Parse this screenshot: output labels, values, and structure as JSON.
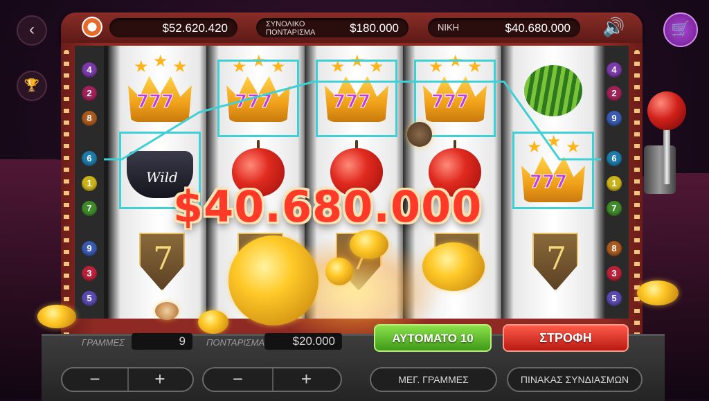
{
  "header": {
    "balance": "$52.620.420",
    "total_bet_label_line1": "ΣΥΝΟΛΙΚΟ",
    "total_bet_label_line2": "ΠΟΝΤΑΡΙΣΜΑ",
    "total_bet": "$180.000",
    "win_label": "ΝΙΚΗ",
    "win_value": "$40.680.000"
  },
  "left_numbers": [
    "4",
    "2",
    "8",
    "6",
    "1",
    "7",
    "9",
    "3",
    "5"
  ],
  "right_numbers": [
    "4",
    "2",
    "9",
    "6",
    "1",
    "7",
    "8",
    "3",
    "5"
  ],
  "number_colors": {
    "1": "#c9b21a",
    "2": "#a0225a",
    "3": "#b8223a",
    "4": "#7a3aa8",
    "5": "#5a4ab0",
    "6": "#1e7aa8",
    "7": "#3f8a2a",
    "8": "#a85a1e",
    "9": "#3a5ab0"
  },
  "reels": [
    [
      "crown",
      "wild-hat",
      "seven-shield"
    ],
    [
      "crown",
      "apple",
      "seven-shield"
    ],
    [
      "crown",
      "apple",
      "seven-shield"
    ],
    [
      "crown",
      "apple",
      "seven-shield"
    ],
    [
      "watermelon",
      "crown",
      "seven-shield"
    ]
  ],
  "symbols": {
    "crown_text": "777",
    "wild_text": "Wild",
    "seven_text": "7"
  },
  "big_win": "$40.680.000",
  "controls": {
    "lines_label": "ΓΡΑΜΜΕΣ",
    "lines_value": "9",
    "bet_label": "ΠΟΝΤΑΡΙΣΜΑ",
    "bet_value": "$20.000",
    "auto_button": "ΑΥΤΟΜΑΤΟ 10",
    "spin_button": "ΣΤΡΟΦΗ",
    "max_lines_button": "ΜΕΓ. ΓΡΑΜΜΕΣ",
    "paytable_button": "ΠΙΝΑΚΑΣ ΣΥΝΔΙΑΣΜΩΝ",
    "minus": "−",
    "plus": "+"
  },
  "icons": {
    "back": "‹",
    "trophy": "🏆",
    "cart": "🛒",
    "speaker": "🔊"
  }
}
